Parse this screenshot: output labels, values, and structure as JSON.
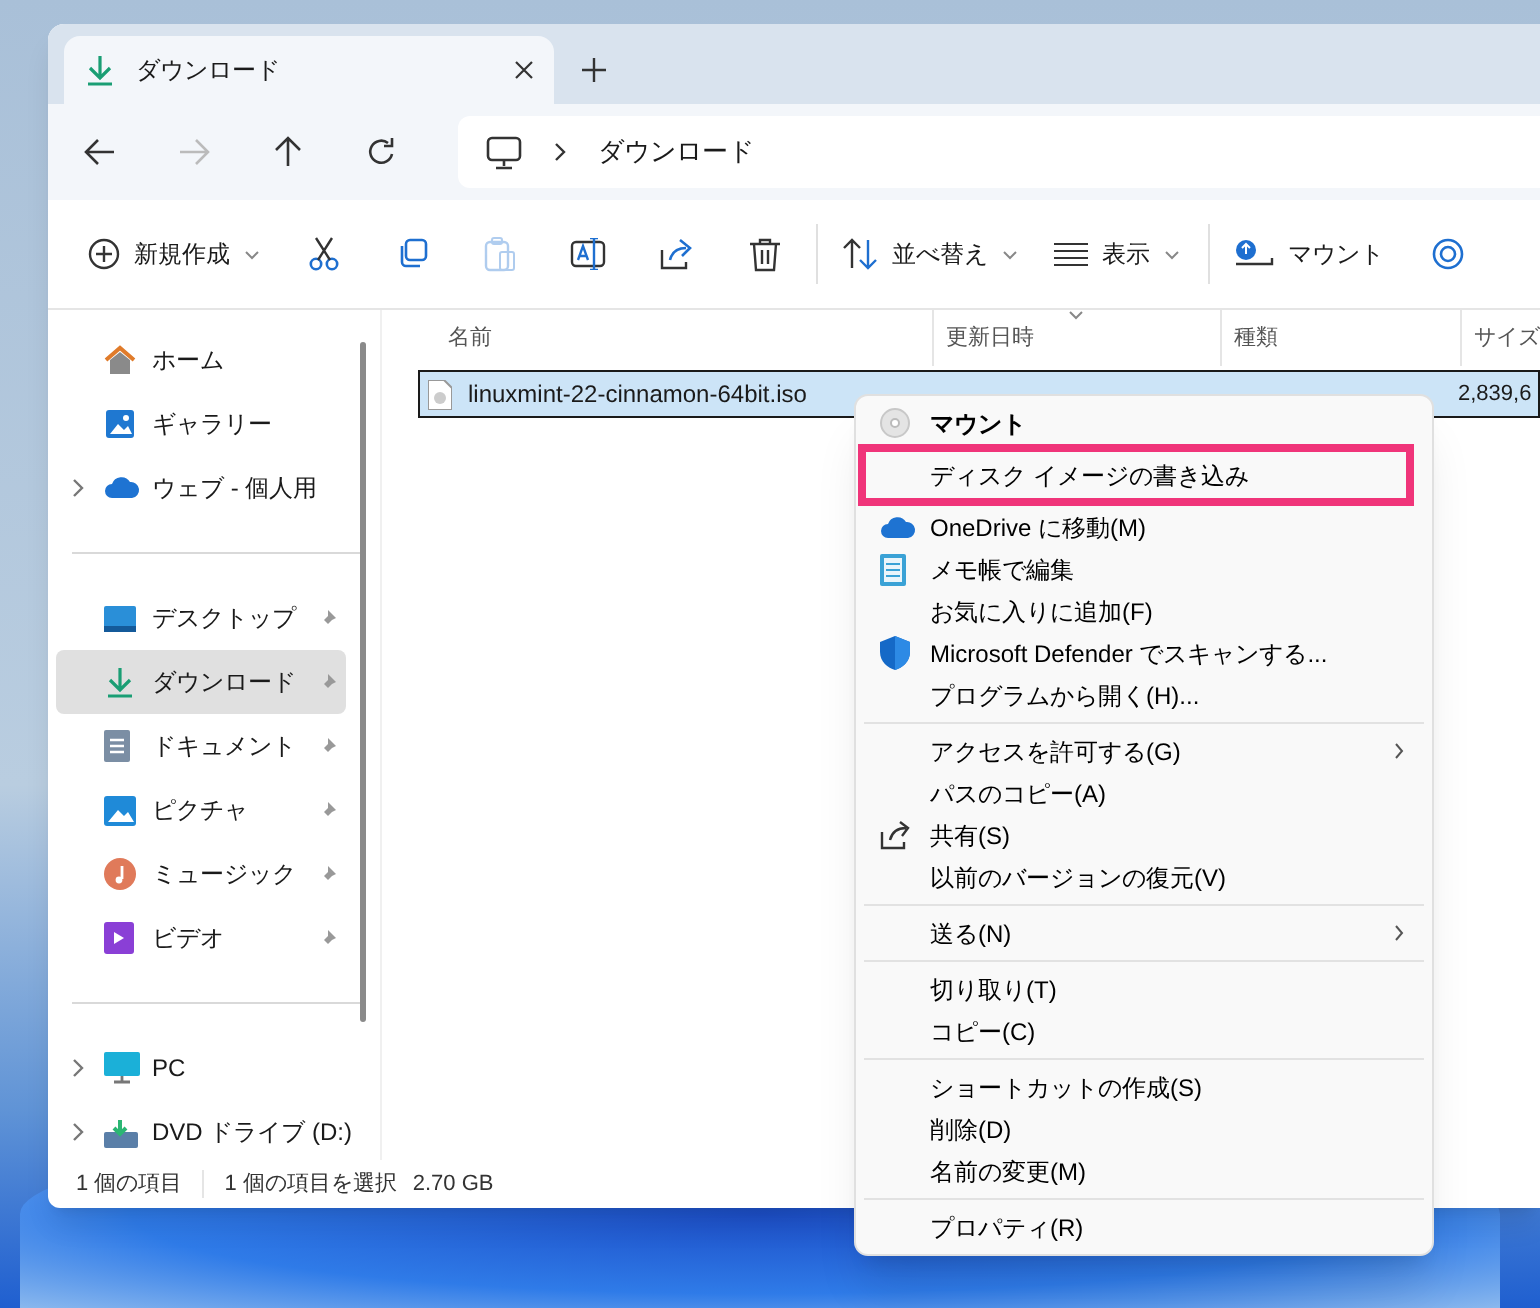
{
  "tab": {
    "title": "ダウンロード",
    "selected": true
  },
  "nav": {
    "back_disabled": false,
    "forward_disabled": true
  },
  "address": {
    "path": "ダウンロード"
  },
  "toolbar": [
    {
      "kind": "new",
      "label": "新規作成",
      "dropdown": true,
      "disabled": false
    },
    {
      "kind": "cut",
      "disabled": false
    },
    {
      "kind": "copy",
      "disabled": false
    },
    {
      "kind": "paste",
      "disabled": true
    },
    {
      "kind": "rename",
      "disabled": false
    },
    {
      "kind": "share",
      "disabled": false
    },
    {
      "kind": "delete",
      "disabled": false
    },
    {
      "kind": "separator"
    },
    {
      "kind": "sort",
      "label": "並べ替え",
      "dropdown": true,
      "disabled": false
    },
    {
      "kind": "view",
      "label": "表示",
      "dropdown": true,
      "disabled": false
    },
    {
      "kind": "separator"
    },
    {
      "kind": "mount",
      "label": "マウント",
      "dropdown": false,
      "disabled": false
    },
    {
      "kind": "burn",
      "disabled": false
    }
  ],
  "sidebar": {
    "groups": [
      [
        {
          "label": "ホーム",
          "expandable": false,
          "pinned": false,
          "selected": false
        },
        {
          "label": "ギャラリー",
          "expandable": false,
          "pinned": false,
          "selected": false
        },
        {
          "label": "ウェブ - 個人用",
          "expandable": true,
          "pinned": false,
          "selected": false
        }
      ],
      [
        {
          "label": "デスクトップ",
          "expandable": false,
          "pinned": true,
          "selected": false
        },
        {
          "label": "ダウンロード",
          "expandable": false,
          "pinned": true,
          "selected": true
        },
        {
          "label": "ドキュメント",
          "expandable": false,
          "pinned": true,
          "selected": false
        },
        {
          "label": "ピクチャ",
          "expandable": false,
          "pinned": true,
          "selected": false
        },
        {
          "label": "ミュージック",
          "expandable": false,
          "pinned": true,
          "selected": false
        },
        {
          "label": "ビデオ",
          "expandable": false,
          "pinned": true,
          "selected": false
        }
      ],
      [
        {
          "label": "PC",
          "expandable": true,
          "pinned": false,
          "selected": false
        },
        {
          "label": "DVD ドライブ (D:)",
          "expandable": true,
          "pinned": false,
          "selected": false
        }
      ]
    ]
  },
  "table": {
    "columns": [
      "名前",
      "更新日時",
      "種類",
      "サイズ"
    ],
    "rows": [
      {
        "name": "linuxmint-22-cinnamon-64bit.iso",
        "size": "2,839,6",
        "selected": true
      }
    ]
  },
  "status_bar": {
    "count": "1 個の項目",
    "selection": "1 個の項目を選択",
    "size": "2.70 GB"
  },
  "context_menu": [
    {
      "kind": "item",
      "label": "マウント",
      "bold": true,
      "submenu": false,
      "highlighted": false
    },
    {
      "kind": "item",
      "label": "ディスク イメージの書き込み",
      "bold": false,
      "submenu": false,
      "highlighted": true
    },
    {
      "kind": "item",
      "label": "OneDrive に移動(M)",
      "bold": false,
      "submenu": false,
      "highlighted": false
    },
    {
      "kind": "item",
      "label": "メモ帳で編集",
      "bold": false,
      "submenu": false,
      "highlighted": false
    },
    {
      "kind": "item",
      "label": "お気に入りに追加(F)",
      "bold": false,
      "submenu": false,
      "highlighted": false
    },
    {
      "kind": "item",
      "label": "Microsoft Defender でスキャンする...",
      "bold": false,
      "submenu": false,
      "highlighted": false
    },
    {
      "kind": "item",
      "label": "プログラムから開く(H)...",
      "bold": false,
      "submenu": false,
      "highlighted": false
    },
    {
      "kind": "separator"
    },
    {
      "kind": "item",
      "label": "アクセスを許可する(G)",
      "bold": false,
      "submenu": true,
      "highlighted": false
    },
    {
      "kind": "item",
      "label": "パスのコピー(A)",
      "bold": false,
      "submenu": false,
      "highlighted": false
    },
    {
      "kind": "item",
      "label": "共有(S)",
      "bold": false,
      "submenu": false,
      "highlighted": false
    },
    {
      "kind": "item",
      "label": "以前のバージョンの復元(V)",
      "bold": false,
      "submenu": false,
      "highlighted": false
    },
    {
      "kind": "separator"
    },
    {
      "kind": "item",
      "label": "送る(N)",
      "bold": false,
      "submenu": true,
      "highlighted": false
    },
    {
      "kind": "separator"
    },
    {
      "kind": "item",
      "label": "切り取り(T)",
      "bold": false,
      "submenu": false,
      "highlighted": false
    },
    {
      "kind": "item",
      "label": "コピー(C)",
      "bold": false,
      "submenu": false,
      "highlighted": false
    },
    {
      "kind": "separator"
    },
    {
      "kind": "item",
      "label": "ショートカットの作成(S)",
      "bold": false,
      "submenu": false,
      "highlighted": false
    },
    {
      "kind": "item",
      "label": "削除(D)",
      "bold": false,
      "submenu": false,
      "highlighted": false
    },
    {
      "kind": "item",
      "label": "名前の変更(M)",
      "bold": false,
      "submenu": false,
      "highlighted": false
    },
    {
      "kind": "separator"
    },
    {
      "kind": "item",
      "label": "プロパティ(R)",
      "bold": false,
      "submenu": false,
      "highlighted": false
    }
  ]
}
